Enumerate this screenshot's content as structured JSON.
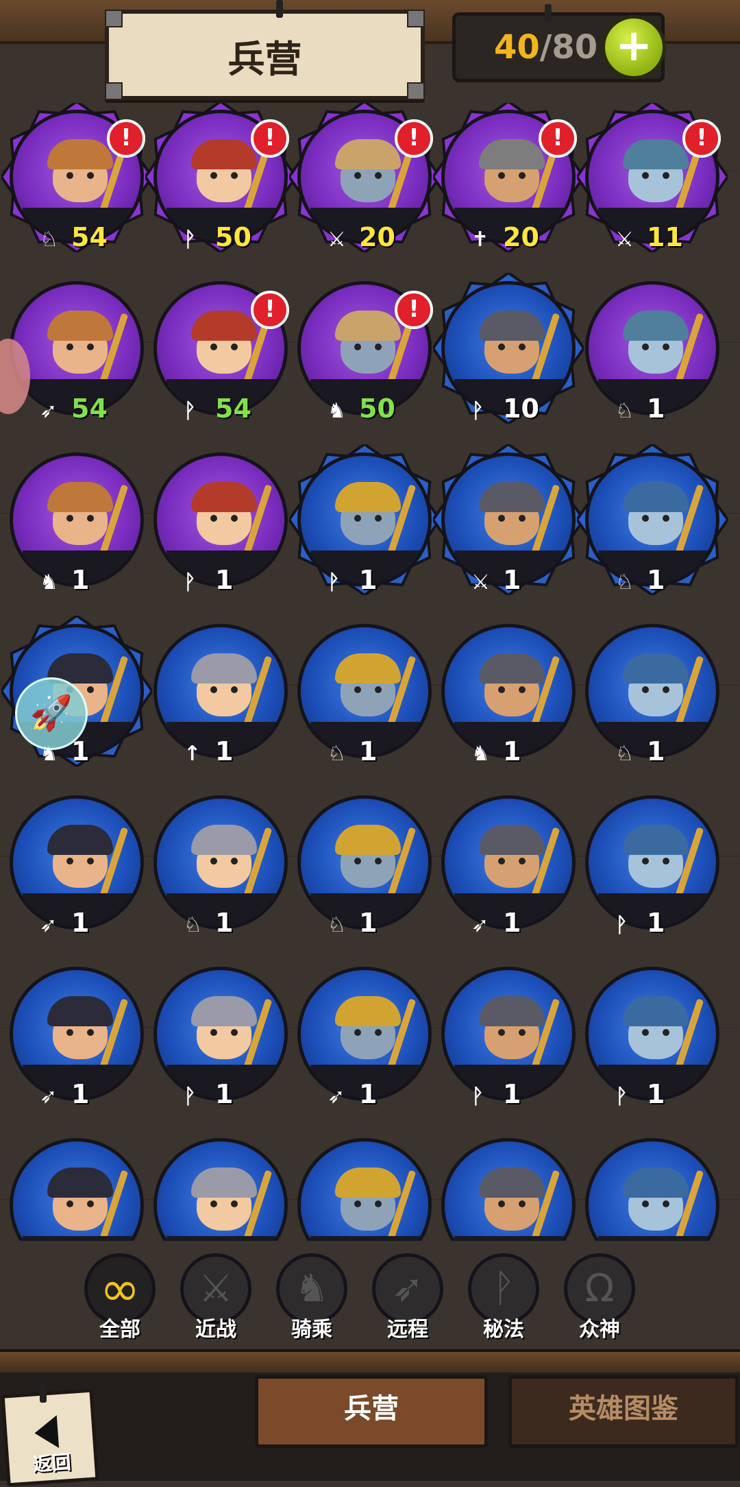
{
  "header": {
    "title": "兵营",
    "capacity_current": "40",
    "capacity_separator": "/",
    "capacity_max": "80",
    "add_icon": "plus-icon",
    "add_label": "+"
  },
  "units": [
    {
      "color": "purple",
      "spiky": true,
      "class_icon": "mount-icon",
      "class_glyph": "♘",
      "level": "54",
      "level_color": "yellow",
      "alert": true
    },
    {
      "color": "purple",
      "spiky": true,
      "class_icon": "arcane-icon",
      "class_glyph": "ᚹ",
      "level": "50",
      "level_color": "yellow",
      "alert": true
    },
    {
      "color": "purple",
      "spiky": true,
      "class_icon": "sword-icon",
      "class_glyph": "⚔",
      "level": "20",
      "level_color": "yellow",
      "alert": true
    },
    {
      "color": "purple",
      "spiky": true,
      "class_icon": "pantheon-icon",
      "class_glyph": "✝",
      "level": "20",
      "level_color": "yellow",
      "alert": true
    },
    {
      "color": "purple",
      "spiky": true,
      "class_icon": "sword-icon",
      "class_glyph": "⚔",
      "level": "11",
      "level_color": "yellow",
      "alert": true
    },
    {
      "color": "purple",
      "spiky": false,
      "class_icon": "bow-icon",
      "class_glyph": "➶",
      "level": "54",
      "level_color": "green",
      "alert": false
    },
    {
      "color": "purple",
      "spiky": false,
      "class_icon": "arcane-icon",
      "class_glyph": "ᚹ",
      "level": "54",
      "level_color": "green",
      "alert": true
    },
    {
      "color": "purple",
      "spiky": false,
      "class_icon": "horse-icon",
      "class_glyph": "♞",
      "level": "50",
      "level_color": "green",
      "alert": true
    },
    {
      "color": "blue",
      "spiky": true,
      "class_icon": "arcane-icon",
      "class_glyph": "ᚹ",
      "level": "10",
      "level_color": "white",
      "alert": false
    },
    {
      "color": "purple",
      "spiky": false,
      "class_icon": "mount-icon",
      "class_glyph": "♘",
      "level": "1",
      "level_color": "white",
      "alert": false
    },
    {
      "color": "purple",
      "spiky": false,
      "class_icon": "horse-icon",
      "class_glyph": "♞",
      "level": "1",
      "level_color": "white",
      "alert": false
    },
    {
      "color": "purple",
      "spiky": false,
      "class_icon": "arcane-icon",
      "class_glyph": "ᚹ",
      "level": "1",
      "level_color": "white",
      "alert": false
    },
    {
      "color": "blue",
      "spiky": true,
      "class_icon": "arcane-icon",
      "class_glyph": "ᚹ",
      "level": "1",
      "level_color": "white",
      "alert": false
    },
    {
      "color": "blue",
      "spiky": true,
      "class_icon": "sword-icon",
      "class_glyph": "⚔",
      "level": "1",
      "level_color": "white",
      "alert": false
    },
    {
      "color": "blue",
      "spiky": true,
      "class_icon": "mount-icon",
      "class_glyph": "♘",
      "level": "1",
      "level_color": "white",
      "alert": false
    },
    {
      "color": "blue",
      "spiky": true,
      "class_icon": "horse-icon",
      "class_glyph": "♞",
      "level": "1",
      "level_color": "white",
      "alert": false
    },
    {
      "color": "blue",
      "spiky": false,
      "class_icon": "spear-icon",
      "class_glyph": "↑",
      "level": "1",
      "level_color": "white",
      "alert": false
    },
    {
      "color": "blue",
      "spiky": false,
      "class_icon": "mount-icon",
      "class_glyph": "♘",
      "level": "1",
      "level_color": "white",
      "alert": false
    },
    {
      "color": "blue",
      "spiky": false,
      "class_icon": "horse-icon",
      "class_glyph": "♞",
      "level": "1",
      "level_color": "white",
      "alert": false
    },
    {
      "color": "blue",
      "spiky": false,
      "class_icon": "mount-icon",
      "class_glyph": "♘",
      "level": "1",
      "level_color": "white",
      "alert": false
    },
    {
      "color": "blue",
      "spiky": false,
      "class_icon": "bow-icon",
      "class_glyph": "➶",
      "level": "1",
      "level_color": "white",
      "alert": false
    },
    {
      "color": "blue",
      "spiky": false,
      "class_icon": "mount-icon",
      "class_glyph": "♘",
      "level": "1",
      "level_color": "white",
      "alert": false
    },
    {
      "color": "blue",
      "spiky": false,
      "class_icon": "mount-icon",
      "class_glyph": "♘",
      "level": "1",
      "level_color": "white",
      "alert": false
    },
    {
      "color": "blue",
      "spiky": false,
      "class_icon": "bow-icon",
      "class_glyph": "➶",
      "level": "1",
      "level_color": "white",
      "alert": false
    },
    {
      "color": "blue",
      "spiky": false,
      "class_icon": "arcane-icon",
      "class_glyph": "ᚹ",
      "level": "1",
      "level_color": "white",
      "alert": false
    },
    {
      "color": "blue",
      "spiky": false,
      "class_icon": "bow-icon",
      "class_glyph": "➶",
      "level": "1",
      "level_color": "white",
      "alert": false
    },
    {
      "color": "blue",
      "spiky": false,
      "class_icon": "arcane-icon",
      "class_glyph": "ᚹ",
      "level": "1",
      "level_color": "white",
      "alert": false
    },
    {
      "color": "blue",
      "spiky": false,
      "class_icon": "bow-icon",
      "class_glyph": "➶",
      "level": "1",
      "level_color": "white",
      "alert": false
    },
    {
      "color": "blue",
      "spiky": false,
      "class_icon": "arcane-icon",
      "class_glyph": "ᚹ",
      "level": "1",
      "level_color": "white",
      "alert": false
    },
    {
      "color": "blue",
      "spiky": false,
      "class_icon": "arcane-icon",
      "class_glyph": "ᚹ",
      "level": "1",
      "level_color": "white",
      "alert": false
    },
    {
      "color": "blue",
      "spiky": false,
      "class_icon": "",
      "class_glyph": "",
      "level": "",
      "level_color": "white",
      "alert": false
    },
    {
      "color": "blue",
      "spiky": false,
      "class_icon": "",
      "class_glyph": "",
      "level": "",
      "level_color": "white",
      "alert": false
    },
    {
      "color": "blue",
      "spiky": false,
      "class_icon": "",
      "class_glyph": "",
      "level": "",
      "level_color": "white",
      "alert": false
    },
    {
      "color": "blue",
      "spiky": false,
      "class_icon": "",
      "class_glyph": "",
      "level": "",
      "level_color": "white",
      "alert": false
    },
    {
      "color": "blue",
      "spiky": false,
      "class_icon": "",
      "class_glyph": "",
      "level": "",
      "level_color": "white",
      "alert": false
    }
  ],
  "filters": [
    {
      "label": "全部",
      "icon": "infinity-icon",
      "glyph": "∞",
      "active": true
    },
    {
      "label": "近战",
      "icon": "sword-icon",
      "glyph": "⚔",
      "active": false
    },
    {
      "label": "骑乘",
      "icon": "horse-icon",
      "glyph": "♞",
      "active": false
    },
    {
      "label": "远程",
      "icon": "bow-icon",
      "glyph": "➶",
      "active": false
    },
    {
      "label": "秘法",
      "icon": "arcane-icon",
      "glyph": "ᚹ",
      "active": false
    },
    {
      "label": "众神",
      "icon": "omega-icon",
      "glyph": "Ω",
      "active": false
    }
  ],
  "tabs": {
    "barracks": "兵营",
    "hero_codex": "英雄图鉴"
  },
  "back": {
    "label": "返回",
    "icon": "back-arrow-icon"
  },
  "floating": {
    "rocket_icon": "rocket-icon"
  },
  "colors": {
    "alert": "#e0202a",
    "level_yellow": "#ffe63a",
    "level_green": "#7ee34a",
    "purple_badge": "#7a2dbf",
    "blue_badge": "#1d4fb8",
    "active_filter": "#f3c420"
  }
}
